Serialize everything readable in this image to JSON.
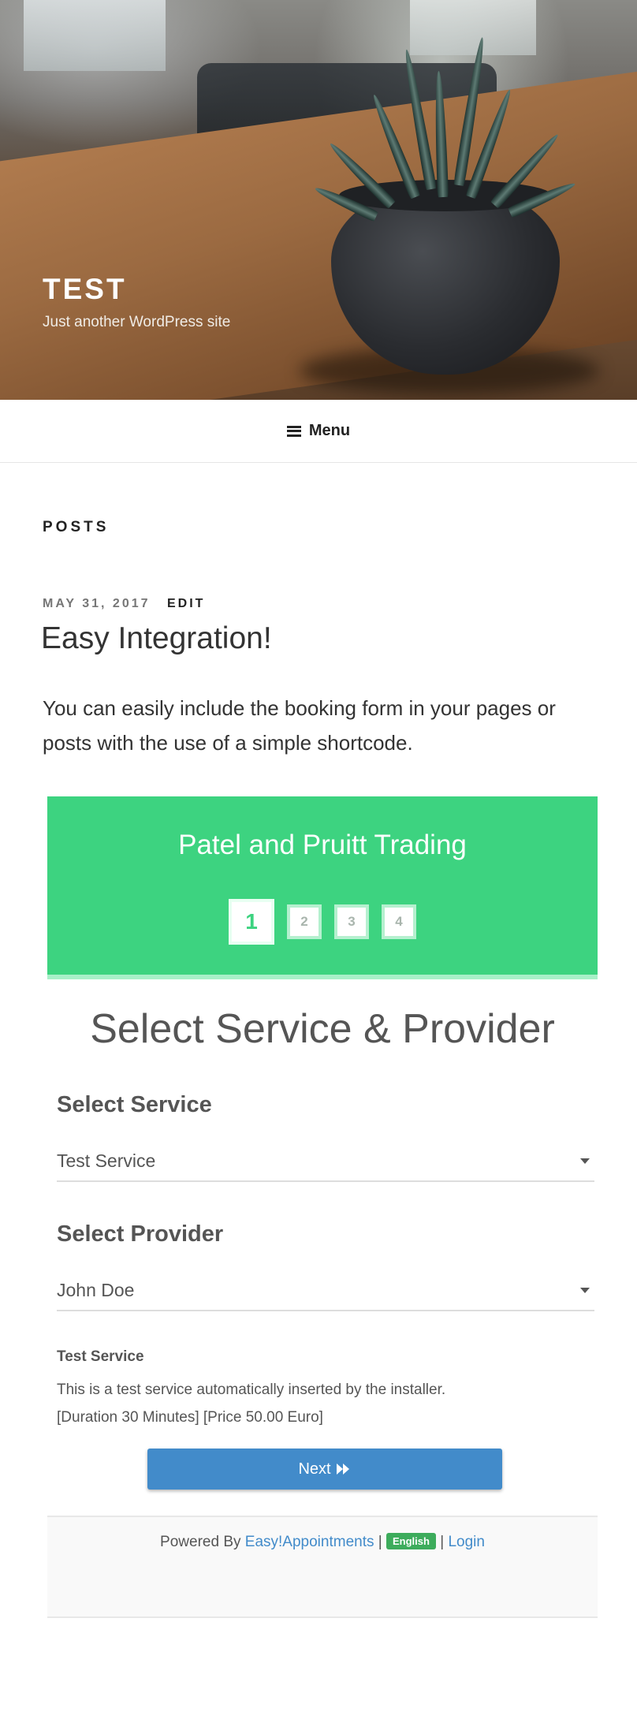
{
  "site": {
    "title": "TEST",
    "tagline": "Just another WordPress site"
  },
  "nav": {
    "menu_label": "Menu"
  },
  "content": {
    "section_heading": "POSTS",
    "post": {
      "date": "MAY 31, 2017",
      "edit_label": "EDIT",
      "title": "Easy Integration!",
      "body": "You can easily include the booking form in your pages or posts with the use of a simple shortcode."
    }
  },
  "booking": {
    "company_name": "Patel and Pruitt Trading",
    "steps": [
      "1",
      "2",
      "3",
      "4"
    ],
    "active_step": 1,
    "heading": "Select Service & Provider",
    "service_label": "Select Service",
    "service_value": "Test Service",
    "provider_label": "Select Provider",
    "provider_value": "John Doe",
    "service_info": {
      "name": "Test Service",
      "description": "This is a test service automatically inserted by the installer.",
      "details": "[Duration 30 Minutes] [Price 50.00 Euro]"
    },
    "next_label": "Next",
    "footer": {
      "powered_by": "Powered By",
      "brand_link": "Easy!Appointments",
      "separator": "|",
      "language": "English",
      "login_link": "Login"
    },
    "colors": {
      "header_green": "#3dd380",
      "button_blue": "#428bca",
      "language_badge": "#3dac5c"
    }
  },
  "icons": [
    "hamburger-icon",
    "double-chevron-right-icon",
    "dropdown-caret-icon"
  ]
}
